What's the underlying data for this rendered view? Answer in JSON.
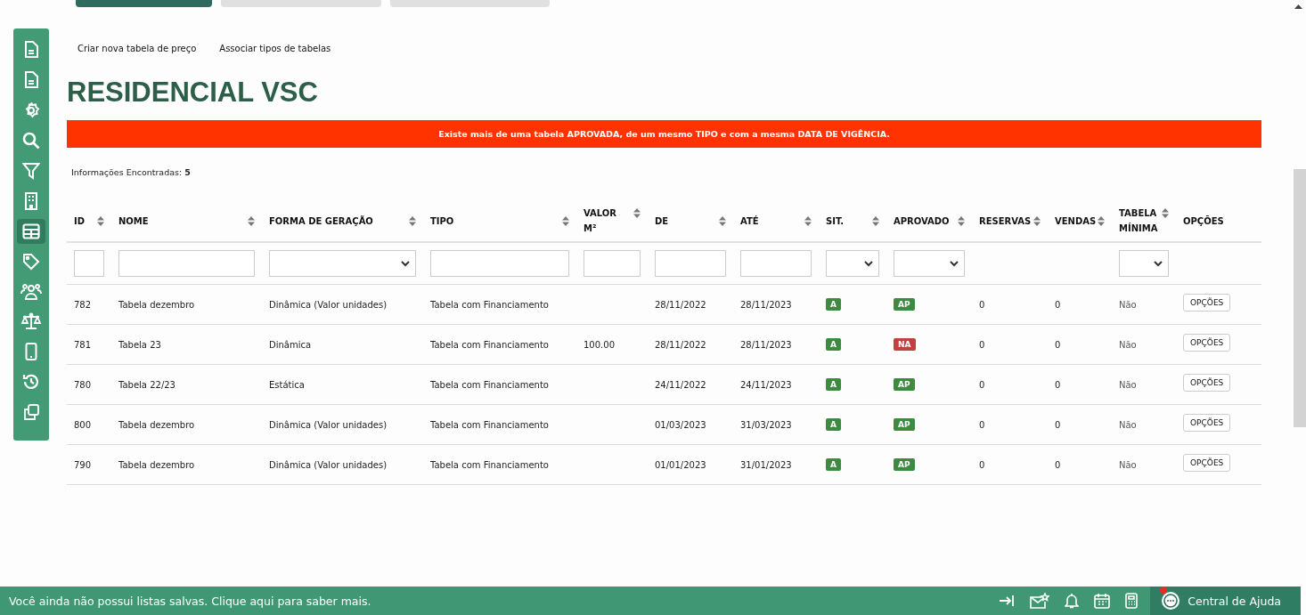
{
  "top_tabs": [
    {
      "selected": true
    },
    {
      "selected": false
    },
    {
      "selected": false
    }
  ],
  "sidebar": [
    {
      "kind": "document",
      "selected": false
    },
    {
      "kind": "document",
      "selected": false
    },
    {
      "kind": "gear",
      "selected": false
    },
    {
      "kind": "search",
      "selected": false
    },
    {
      "kind": "filter",
      "selected": false
    },
    {
      "kind": "building",
      "selected": false
    },
    {
      "kind": "table",
      "selected": true
    },
    {
      "kind": "tag",
      "selected": false
    },
    {
      "kind": "people",
      "selected": false
    },
    {
      "kind": "scales",
      "selected": false
    },
    {
      "kind": "phone",
      "selected": false
    },
    {
      "kind": "history",
      "selected": false
    },
    {
      "kind": "copy",
      "selected": false
    }
  ],
  "links": [
    "Criar nova tabela de preço",
    "Associar tipos de tabelas"
  ],
  "title": "RESIDENCIAL VSC",
  "alert": "Existe mais de uma tabela APROVADA, de um mesmo TIPO e com a mesma DATA DE VIGÊNCIA.",
  "found": {
    "label": "Informações Encontradas:",
    "count": "5"
  },
  "columns": [
    {
      "label": "ID",
      "sortable": true
    },
    {
      "label": "NOME",
      "sortable": true
    },
    {
      "label": "FORMA DE GERAÇÃO",
      "sortable": true
    },
    {
      "label": "TIPO",
      "sortable": true
    },
    {
      "label": "VALOR M²",
      "sortable": true
    },
    {
      "label": "DE",
      "sortable": true
    },
    {
      "label": "ATÉ",
      "sortable": true
    },
    {
      "label": "SIT.",
      "sortable": true
    },
    {
      "label": "APROVADO",
      "sortable": true
    },
    {
      "label": "RESERVAS",
      "sortable": true
    },
    {
      "label": "VENDAS",
      "sortable": true
    },
    {
      "label": "TABELA MÍNIMA",
      "sortable": true
    },
    {
      "label": "OPÇÕES",
      "sortable": false
    }
  ],
  "filters": [
    {
      "kind": "text"
    },
    {
      "kind": "text"
    },
    {
      "kind": "select"
    },
    {
      "kind": "text"
    },
    {
      "kind": "text"
    },
    {
      "kind": "text"
    },
    {
      "kind": "text"
    },
    {
      "kind": "select"
    },
    {
      "kind": "select"
    },
    {
      "kind": "none"
    },
    {
      "kind": "none"
    },
    {
      "kind": "select"
    },
    {
      "kind": "none"
    }
  ],
  "rows": [
    {
      "id": "782",
      "nome": "Tabela dezembro",
      "forma": "Dinâmica (Valor unidades)",
      "tipo": "Tabela com Financiamento",
      "de": "28/11/2022",
      "ate": "28/11/2023",
      "sit": {
        "label": "A",
        "color": "#3d8b40"
      },
      "aprovado": {
        "label": "AP",
        "color": "#3d8b40"
      },
      "reservas": "0",
      "vendas": "0",
      "minima": "Não",
      "options": "OPÇÕES"
    },
    {
      "id": "781",
      "nome": "Tabela 23",
      "forma": "Dinâmica",
      "tipo": "Tabela com Financiamento",
      "valor": "100.00",
      "de": "28/11/2022",
      "ate": "28/11/2023",
      "sit": {
        "label": "A",
        "color": "#3d8b40"
      },
      "aprovado": {
        "label": "NA",
        "color": "#c0413f"
      },
      "reservas": "0",
      "vendas": "0",
      "minima": "Não",
      "options": "OPÇÕES"
    },
    {
      "id": "780",
      "nome": "Tabela 22/23",
      "forma": "Estática",
      "tipo": "Tabela com Financiamento",
      "de": "24/11/2022",
      "ate": "24/11/2023",
      "sit": {
        "label": "A",
        "color": "#3d8b40"
      },
      "aprovado": {
        "label": "AP",
        "color": "#3d8b40"
      },
      "reservas": "0",
      "vendas": "0",
      "minima": "Não",
      "options": "OPÇÕES"
    },
    {
      "id": "800",
      "nome": "Tabela dezembro",
      "forma": "Dinâmica (Valor unidades)",
      "tipo": "Tabela com Financiamento",
      "de": "01/03/2023",
      "ate": "31/03/2023",
      "sit": {
        "label": "A",
        "color": "#3d8b40"
      },
      "aprovado": {
        "label": "AP",
        "color": "#3d8b40"
      },
      "reservas": "0",
      "vendas": "0",
      "minima": "Não",
      "options": "OPÇÕES"
    },
    {
      "id": "790",
      "nome": "Tabela dezembro",
      "forma": "Dinâmica (Valor unidades)",
      "tipo": "Tabela com Financiamento",
      "de": "01/01/2023",
      "ate": "31/01/2023",
      "sit": {
        "label": "A",
        "color": "#3d8b40"
      },
      "aprovado": {
        "label": "AP",
        "color": "#3d8b40"
      },
      "reservas": "0",
      "vendas": "0",
      "minima": "Não",
      "options": "OPÇÕES"
    }
  ],
  "footer": {
    "message": "Você ainda não possui listas salvas. Clique aqui para saber mais.",
    "tools": [
      {
        "kind": "collapse"
      },
      {
        "kind": "mail"
      },
      {
        "kind": "bell"
      },
      {
        "kind": "calendar"
      },
      {
        "kind": "calculator"
      }
    ],
    "help": {
      "label": "Central de Ajuda",
      "notification": true
    }
  }
}
